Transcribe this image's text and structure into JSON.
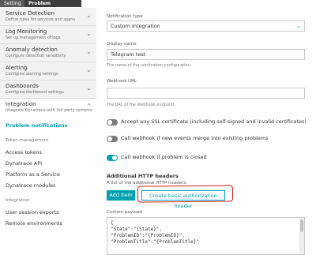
{
  "breadcrumb": {
    "items": [
      "Settings",
      "Problem notifications"
    ]
  },
  "sidebar": {
    "sections": [
      {
        "title": "Service Detection",
        "desc": "Define rules for services and spans"
      },
      {
        "title": "Log Monitoring",
        "desc": "Set up management of logs"
      },
      {
        "title": "Anomaly detection",
        "desc": "Configure detection sensitivity"
      },
      {
        "title": "Alerting",
        "desc": "Configure alerting settings"
      },
      {
        "title": "Dashboards",
        "desc": "Configure dashboard settings"
      },
      {
        "title": "Integration",
        "desc": "Integrate Dynatrace with 3rd party systems"
      }
    ],
    "subitems": {
      "problem_notifications": "Problem notifications",
      "token_management": "Token management",
      "access_tokens": "Access tokens",
      "dynatrace_api": "Dynatrace API",
      "platform_as_a_service": "Platform as a Service",
      "dynatrace_modules": "Dynatrace modules",
      "integration_head": "Integration",
      "user_session_exports": "User session exports",
      "remote_environments": "Remote environments"
    }
  },
  "form": {
    "type_label": "Notification type",
    "type_value": "Custom Integration",
    "name_label": "Display name",
    "name_value": "Telegram test",
    "name_hint": "The name of the notification configuration.",
    "url_label": "Webhook URL",
    "url_value": "",
    "url_hint": "The URL of the Webhook endpoint.",
    "ssl_label": "Accept any SSL certificate (including self-signed and invalid certificates)",
    "ssl_on": false,
    "merge_label": "Call webhook if new events merge into existing problems",
    "merge_on": false,
    "closed_label": "Call webhook if problem is closed",
    "closed_on": true,
    "headers_title": "Additional HTTP headers",
    "headers_desc": "A list of the additional HTTP headers.",
    "add_item": "Add item",
    "basic_auth": "Create basic authorization header",
    "payload_label": "Custom payload",
    "payload_lines": [
      "{",
      "\"State\":\"{State}\",",
      "\"ProblemID\":\"{ProblemID}\",",
      "\"ProblemTitle\":\"{ProblemTitle}\""
    ]
  },
  "colors": {
    "accent": "#00a1b2",
    "annotation": "#d11b1b"
  }
}
